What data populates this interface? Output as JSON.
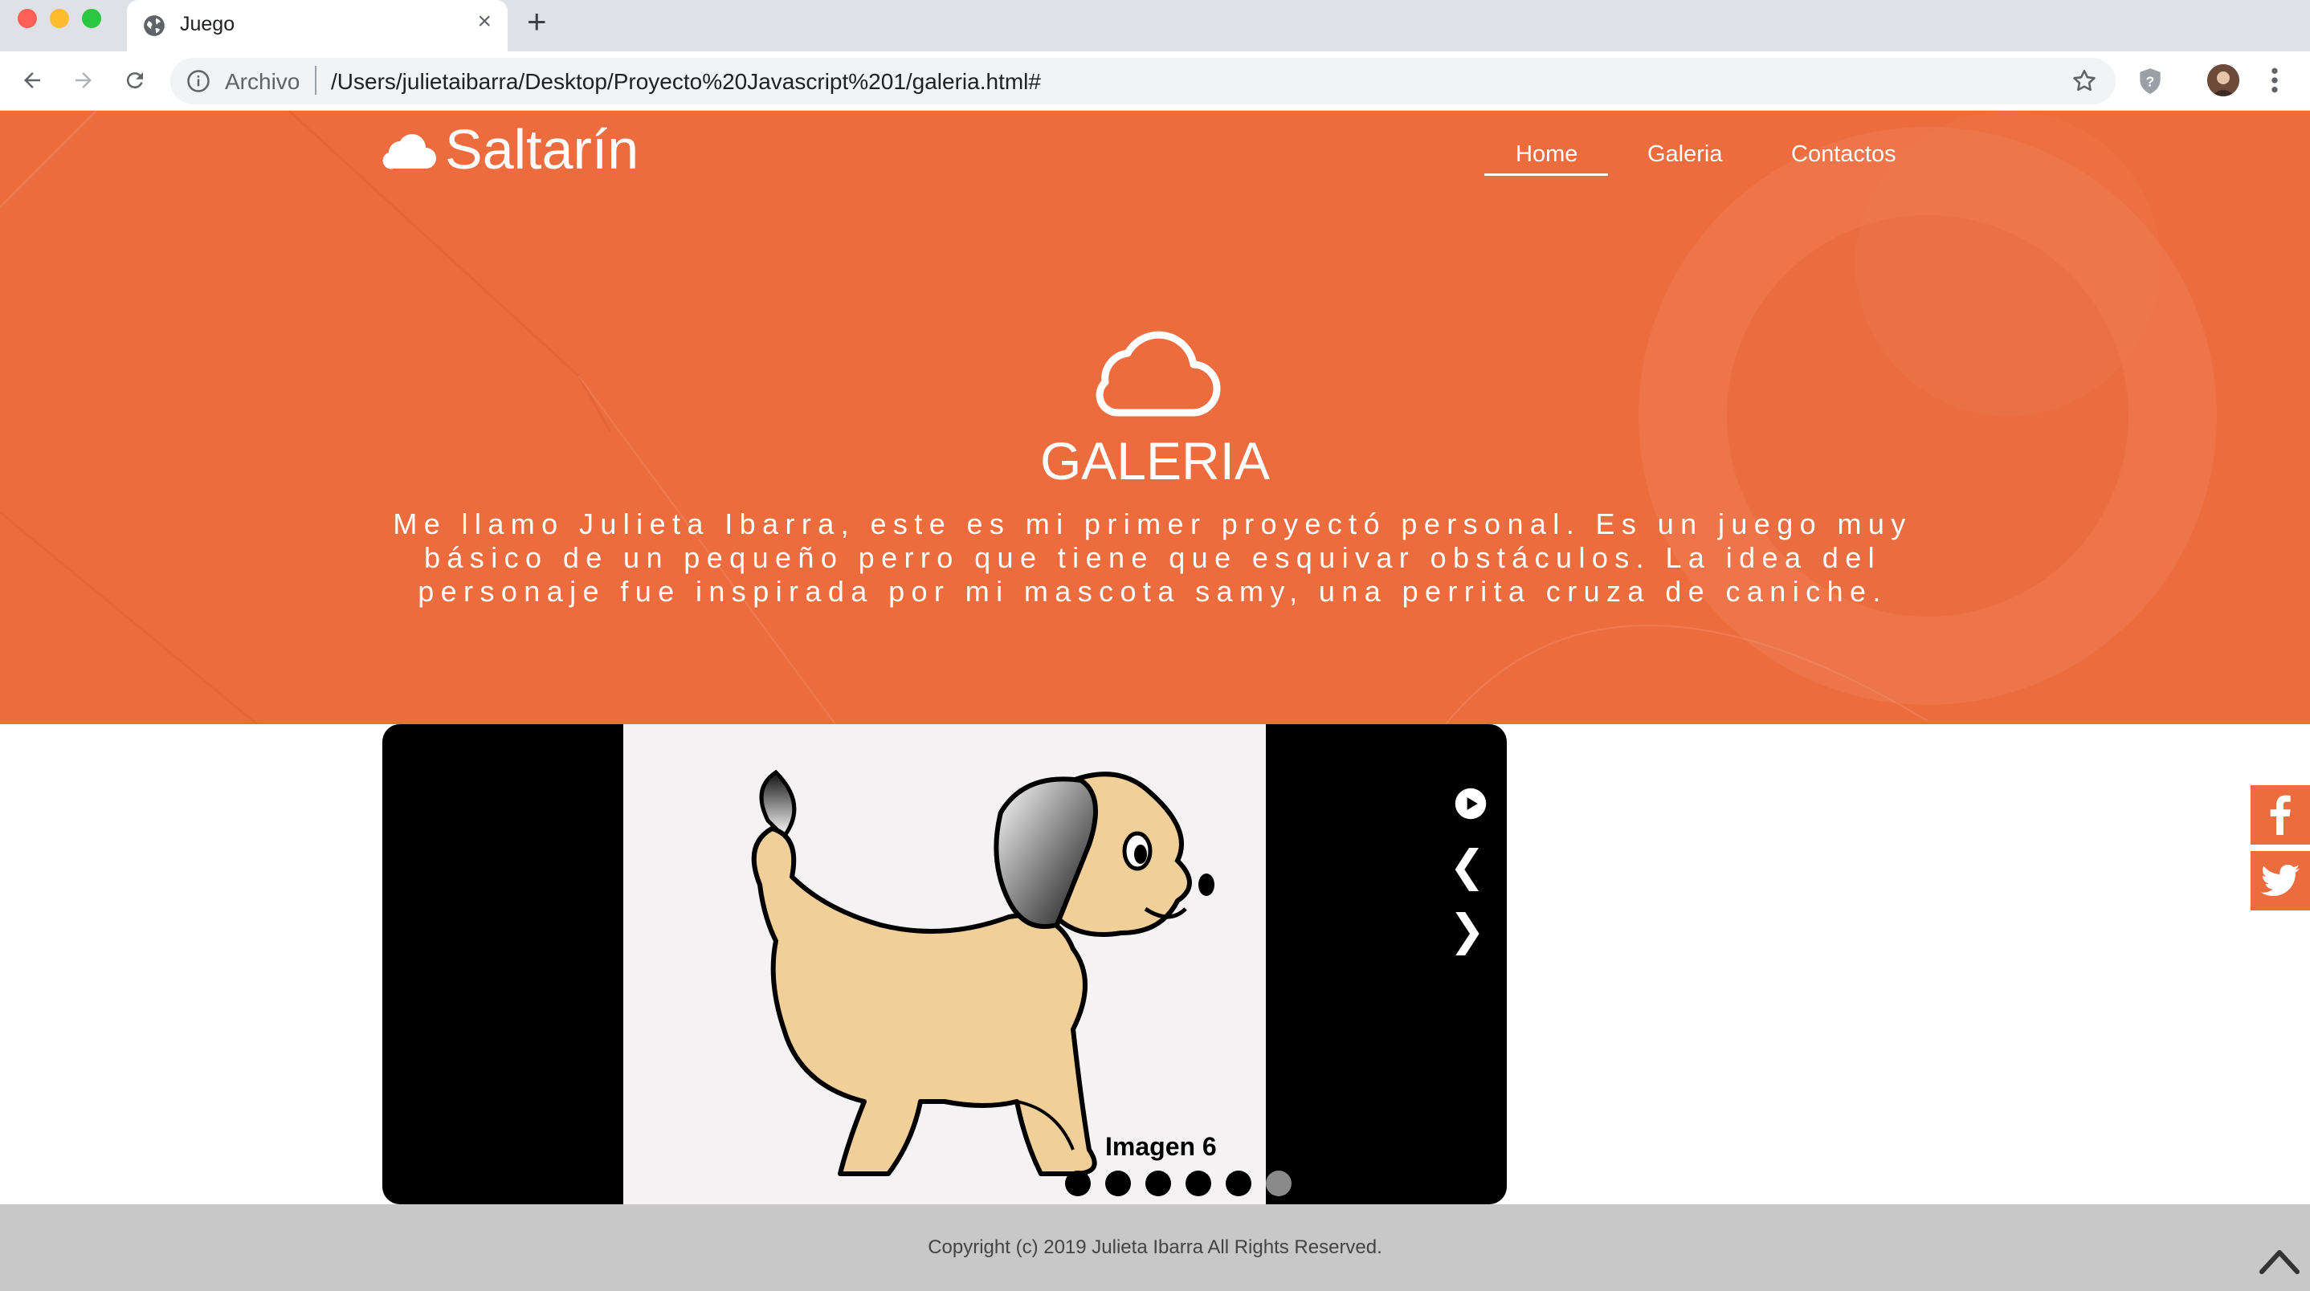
{
  "browser": {
    "tab_title": "Juego",
    "new_tab_symbol": "+",
    "close_symbol": "×",
    "omnibox_scheme": "Archivo",
    "url": "/Users/julietaibarra/Desktop/Proyecto%20Javascript%201/galeria.html#",
    "traffic_colors": [
      "#ff5f57",
      "#febc2e",
      "#28c840"
    ]
  },
  "site": {
    "logo": "Saltarín",
    "nav": [
      "Home",
      "Galeria",
      "Contactos"
    ],
    "active_nav": "Home"
  },
  "hero": {
    "title": "GALERIA",
    "text": "Me llamo Julieta Ibarra, este es mi primer proyectó personal. Es un juego muy básico de un pequeño perro que tiene que esquivar obstáculos. La idea del personaje fue inspirada por mi mascota samy, una perrita cruza de caniche.",
    "accent_color": "#ec6c3e"
  },
  "gallery": {
    "caption": "Imagen 6",
    "prev_symbol": "❮",
    "next_symbol": "❯",
    "dot_count": 6,
    "active_dot": 6
  },
  "social": [
    "facebook-icon",
    "twitter-icon"
  ],
  "footer": {
    "copyright": "Copyright (c) 2019 Julieta Ibarra All Rights Reserved."
  }
}
